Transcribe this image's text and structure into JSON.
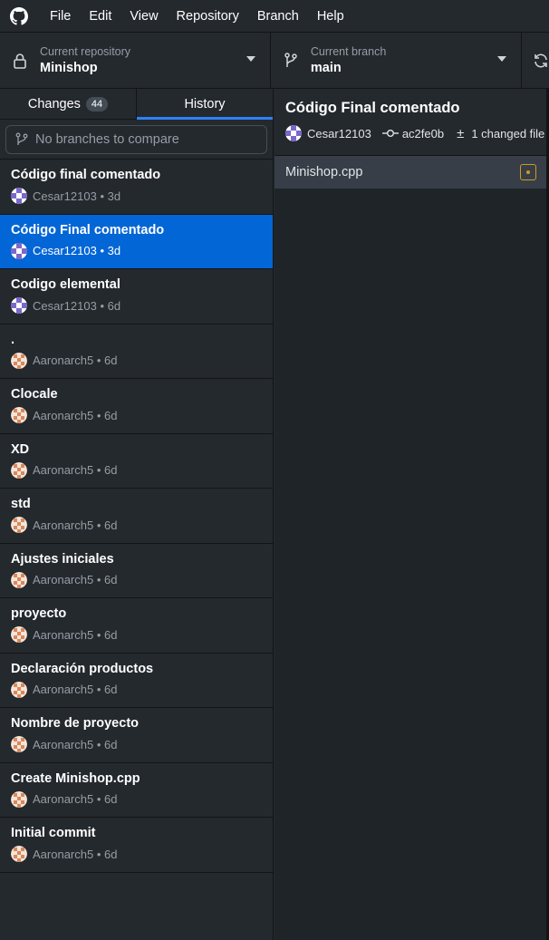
{
  "menubar": {
    "items": [
      "File",
      "Edit",
      "View",
      "Repository",
      "Branch",
      "Help"
    ]
  },
  "toolbar": {
    "repo_label": "Current repository",
    "repo_value": "Minishop",
    "branch_label": "Current branch",
    "branch_value": "main"
  },
  "sidebar": {
    "tabs": [
      {
        "label": "Changes",
        "badge": "44"
      },
      {
        "label": "History"
      }
    ],
    "compare_placeholder": "No branches to compare",
    "commits": [
      {
        "title": "Código final comentado",
        "meta": "Cesar12103 • 3d"
      },
      {
        "title": "Código Final comentado",
        "meta": "Cesar12103 • 3d"
      },
      {
        "title": "Codigo elemental",
        "meta": "Cesar12103 • 6d"
      },
      {
        "title": ".",
        "meta": "Aaronarch5 • 6d"
      },
      {
        "title": "Clocale",
        "meta": "Aaronarch5 • 6d"
      },
      {
        "title": "XD",
        "meta": "Aaronarch5 • 6d"
      },
      {
        "title": "std",
        "meta": "Aaronarch5 • 6d"
      },
      {
        "title": "Ajustes iniciales",
        "meta": "Aaronarch5 • 6d"
      },
      {
        "title": "proyecto",
        "meta": "Aaronarch5 • 6d"
      },
      {
        "title": "Declaración productos",
        "meta": "Aaronarch5 • 6d"
      },
      {
        "title": "Nombre de proyecto",
        "meta": "Aaronarch5 • 6d"
      },
      {
        "title": "Create Minishop.cpp",
        "meta": "Aaronarch5 • 6d"
      },
      {
        "title": "Initial commit",
        "meta": "Aaronarch5 • 6d"
      }
    ]
  },
  "main": {
    "title": "Código Final comentado",
    "author": "Cesar12103",
    "sha": "ac2fe0b",
    "changed": "1 changed file",
    "files": [
      {
        "name": "Minishop.cpp"
      }
    ]
  },
  "colors": {
    "accent": "#0366d6",
    "modified": "#d29922",
    "avatar_cesar": "#7b68c9",
    "avatar_aaron": "#d6895c"
  }
}
